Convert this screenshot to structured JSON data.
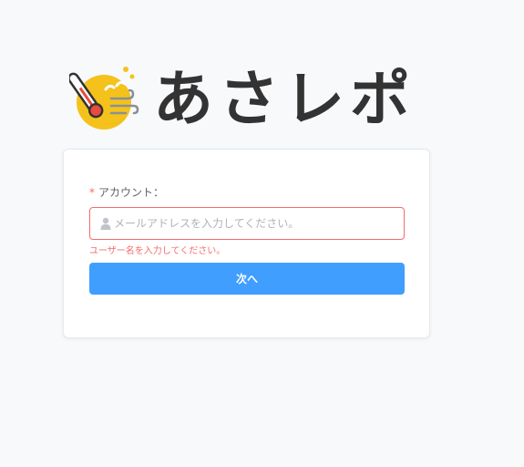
{
  "brand": {
    "name": "あさレポ",
    "logo_icon": "sun-thermometer-logo-icon",
    "colors": {
      "logo_text": "#333333",
      "logo_sun": "#f4c21b"
    }
  },
  "login_form": {
    "account_label": "アカウント：",
    "required_marker": "*",
    "email_input": {
      "placeholder": "メールアドレスを入力してください。",
      "value": "",
      "icon": "user-icon"
    },
    "error_message": "ユーザー名を入力してください。",
    "next_button_label": "次へ"
  },
  "colors": {
    "primary": "#409eff",
    "error": "#f56c6c",
    "background": "#f8f9fb",
    "card": "#ffffff"
  }
}
